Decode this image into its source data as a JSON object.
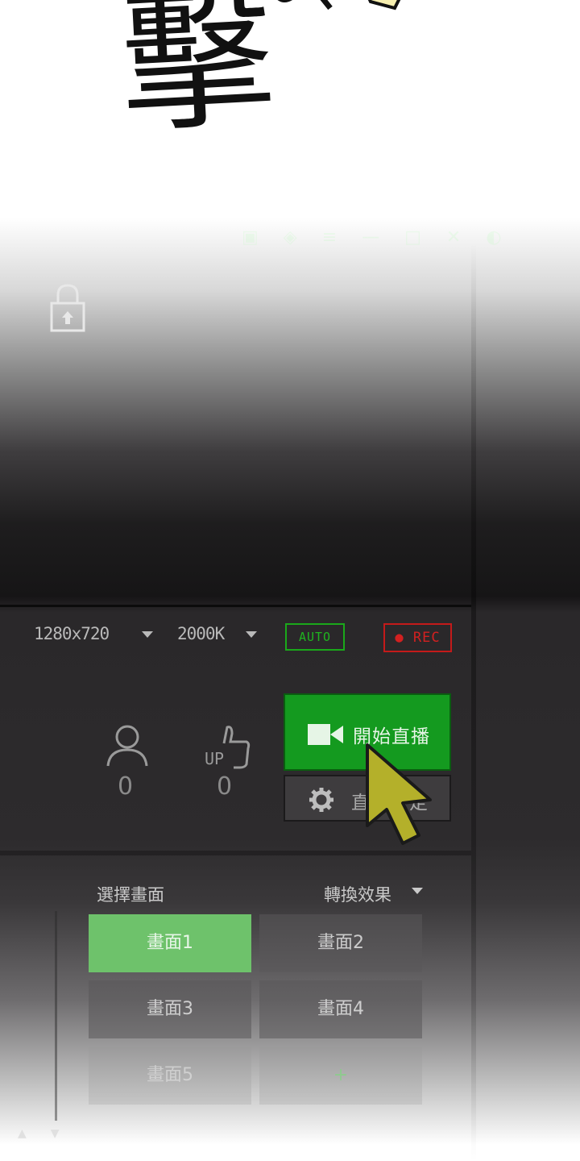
{
  "comic_sfx": {
    "text": "擊"
  },
  "stream": {
    "resolution": "1280x720",
    "bitrate": "2000K",
    "auto_label": "AUTO",
    "rec_label": "● REC"
  },
  "stats": {
    "viewers": "0",
    "likes": "0",
    "like_icon_text": "UP"
  },
  "actions": {
    "start_label": "開始直播",
    "settings_label": "直播設定"
  },
  "scenes": {
    "title": "選擇畫面",
    "transition_label": "轉換效果",
    "items": [
      "畫面1",
      "畫面2",
      "畫面3",
      "畫面4",
      "畫面5",
      "+"
    ],
    "active_index": 0
  },
  "colors": {
    "accent_green": "#149a1f",
    "rec_red": "#d22020",
    "active_scene": "#6ec26b"
  }
}
